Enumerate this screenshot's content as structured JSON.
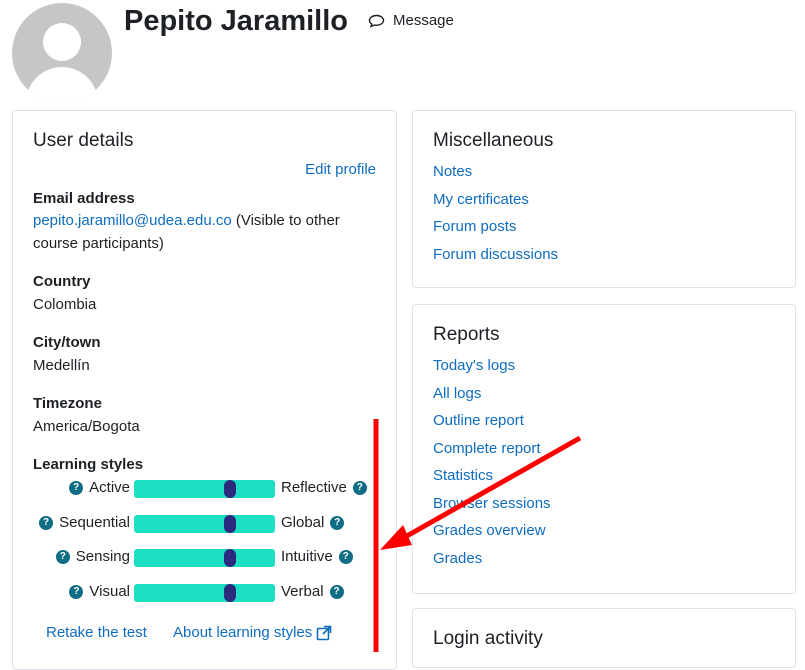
{
  "profile": {
    "name": "Pepito Jaramillo",
    "message_label": "Message"
  },
  "user_details": {
    "title": "User details",
    "edit_profile": "Edit profile",
    "email_label": "Email address",
    "email_value": "pepito.jaramillo@udea.edu.co",
    "email_note": "(Visible to other course participants)",
    "country_label": "Country",
    "country_value": "Colombia",
    "city_label": "City/town",
    "city_value": "Medellín",
    "timezone_label": "Timezone",
    "timezone_value": "America/Bogota",
    "learning_styles_label": "Learning styles",
    "learning_styles": [
      {
        "left": "Active",
        "right": "Reflective",
        "level": 0.68
      },
      {
        "left": "Sequential",
        "right": "Global",
        "level": 0.68
      },
      {
        "left": "Sensing",
        "right": "Intuitive",
        "level": 0.68
      },
      {
        "left": "Visual",
        "right": "Verbal",
        "level": 0.68
      }
    ],
    "help_icon_glyph": "?",
    "retake_label": "Retake the test",
    "about_label": "About learning styles"
  },
  "misc": {
    "title": "Miscellaneous",
    "links": [
      "Notes",
      "My certificates",
      "Forum posts",
      "Forum discussions"
    ]
  },
  "reports": {
    "title": "Reports",
    "links": [
      "Today's logs",
      "All logs",
      "Outline report",
      "Complete report",
      "Statistics",
      "Browser sessions",
      "Grades overview",
      "Grades"
    ]
  },
  "login": {
    "title": "Login activity"
  },
  "colors": {
    "link": "#0f6cbf",
    "bar": "#1ddfc3",
    "knob": "#2b2a7e",
    "help": "#0f6e84",
    "annotation": "#ff0000"
  },
  "icons": {
    "message": "speech-bubble-icon",
    "help": "question-circle-icon",
    "external": "external-link-icon"
  }
}
